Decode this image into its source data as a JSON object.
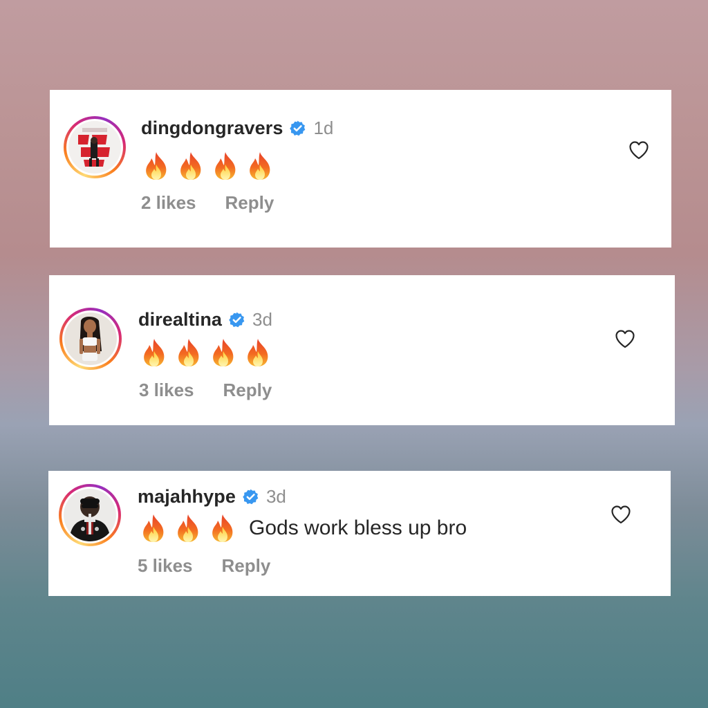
{
  "comments": [
    {
      "username": "dingdongravers",
      "time": "1d",
      "fire_count": 4,
      "text": "",
      "likes": "2 likes",
      "reply": "Reply",
      "avatar_icon": "poster-avatar-icon"
    },
    {
      "username": "direaltina",
      "time": "3d",
      "fire_count": 4,
      "text": "",
      "likes": "3 likes",
      "reply": "Reply",
      "avatar_icon": "person-avatar-icon"
    },
    {
      "username": "majahhype",
      "time": "3d",
      "fire_count": 3,
      "text": "Gods work bless up bro",
      "likes": "5 likes",
      "reply": "Reply",
      "avatar_icon": "person-avatar-icon"
    }
  ],
  "colors": {
    "verified": "#3897f0",
    "username": "#262626",
    "muted": "#8e8e8e"
  }
}
